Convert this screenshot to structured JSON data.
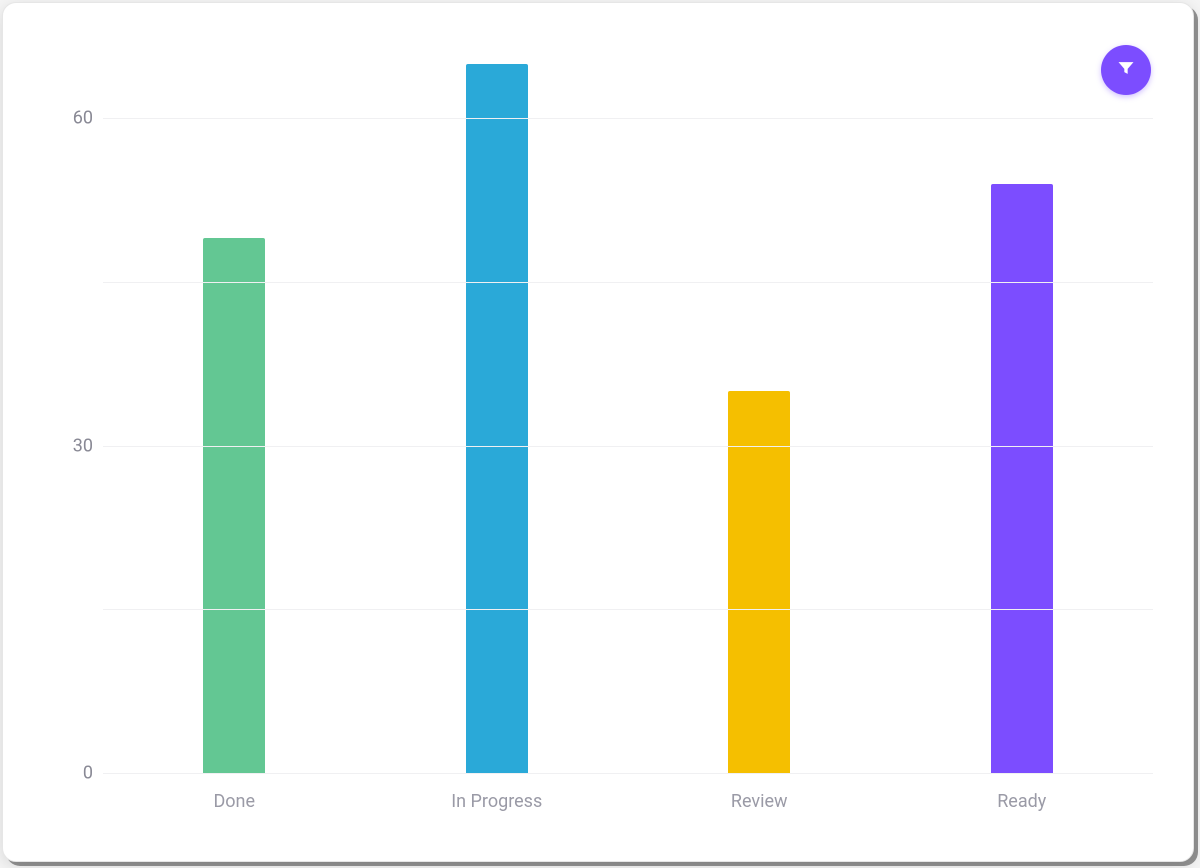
{
  "chart_data": {
    "type": "bar",
    "categories": [
      "Done",
      "In Progress",
      "Review",
      "Ready"
    ],
    "values": [
      49,
      65,
      35,
      54
    ],
    "colors": [
      "#63c793",
      "#2aa9d8",
      "#f5bf00",
      "#7c4dff"
    ],
    "y_ticks": [
      0,
      30,
      60
    ],
    "ylim": [
      0,
      66
    ],
    "title": "",
    "xlabel": "",
    "ylabel": ""
  },
  "controls": {
    "filter_icon": "filter"
  }
}
